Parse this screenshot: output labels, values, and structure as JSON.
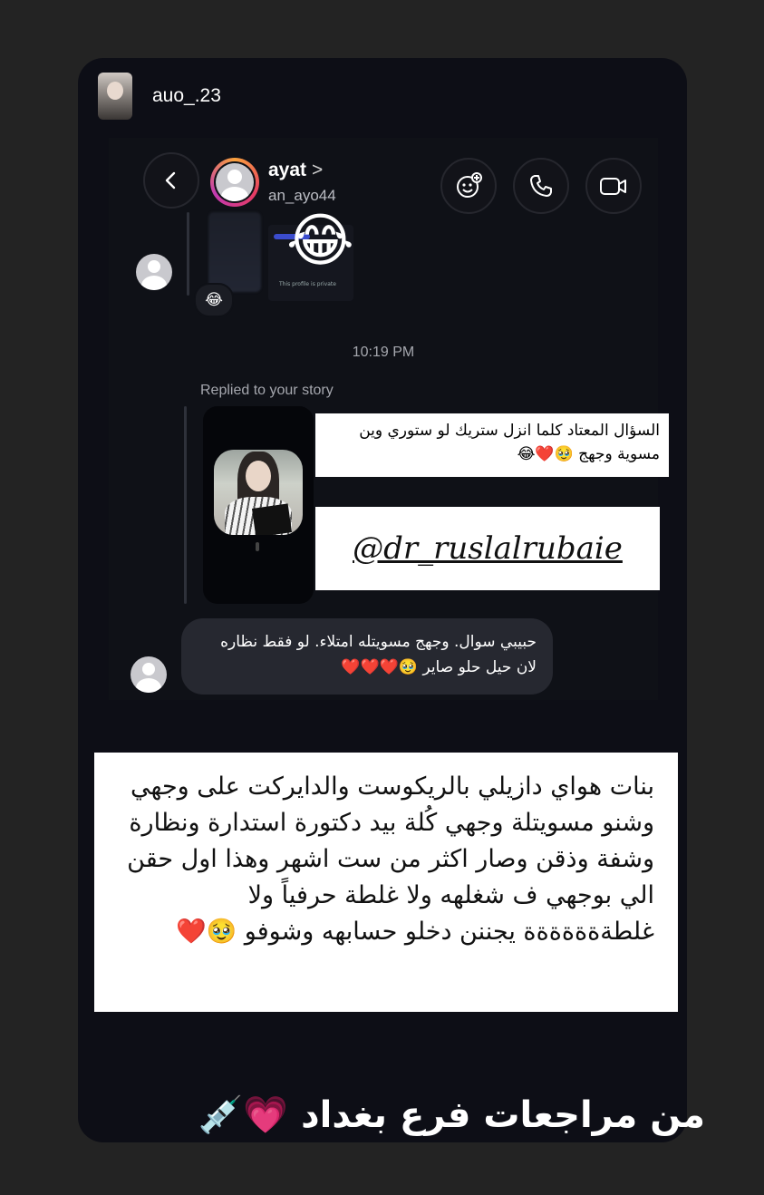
{
  "story": {
    "username": "auo_.23"
  },
  "chat": {
    "contact_name": "ayat",
    "contact_chevron": ">",
    "contact_handle": "an_ayo44",
    "sent_emoji": "😂",
    "reaction_emoji": "😂",
    "timestamp": "10:19 PM",
    "replied_label": "Replied to your story",
    "story_note_text": "السؤال المعتاد كلما انزل ستريك لو ستوري وين مسوية وجهج 🥹❤️😂",
    "story_mention": "@dr_ruslalrubaie",
    "incoming_message": "حبيبي سوال. وجهج مسويتله امتلاء. لو فقط نظاره لان حيل حلو صاير 🥹❤️❤️❤️"
  },
  "caption_text": "بنات هواي دازيلي بالريكوست والدايركت على وجهي وشنو مسويتلة وجهي كُلة بيد دكتورة استدارة ونظارة وشفة وذقن  وصار اكثر من ست اشهر وهذا اول حقن الي بوجهي ف شغلهه ولا غلطة حرفياً ولا غلطةةةةةةة يجننن دخلو حسابهه وشوفو 🥹❤️",
  "footer_caption": "من مراجعات فرع بغداد 💗💉",
  "icons": {
    "back": "chevron-left-icon",
    "effects": "effects-face-icon",
    "call": "phone-icon",
    "video": "video-camera-icon"
  },
  "colors": {
    "page_bg": "#232323",
    "card_bg": "#0d0e16",
    "bubble_bg": "#262830",
    "story_ring": "#e63b63"
  }
}
